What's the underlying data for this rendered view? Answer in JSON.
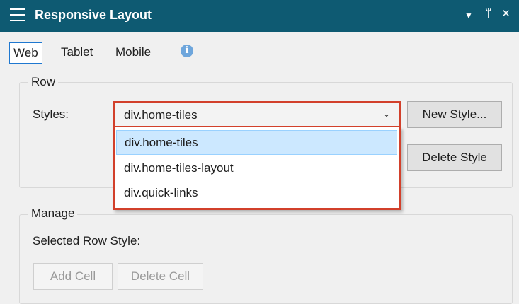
{
  "titlebar": {
    "title": "Responsive Layout",
    "icons": {
      "menu": "hamburger-icon",
      "dropdown": "triangle-down-icon",
      "pin": "pin-icon",
      "close": "close-icon"
    },
    "color": "#0e5a72"
  },
  "tabs": [
    {
      "label": "Web",
      "active": true
    },
    {
      "label": "Tablet",
      "active": false
    },
    {
      "label": "Mobile",
      "active": false
    }
  ],
  "info_icon": "info-icon",
  "row": {
    "title": "Row",
    "styles_label": "Styles:",
    "selected_style": "div.home-tiles",
    "options": [
      "div.home-tiles",
      "div.home-tiles-layout",
      "div.quick-links"
    ],
    "new_style_button": "New Style...",
    "delete_style_button": "Delete Style",
    "highlight_color": "#d2402b"
  },
  "manage": {
    "title": "Manage",
    "selected_row_style_label": "Selected Row Style:",
    "add_cell_button": "Add Cell",
    "delete_cell_button": "Delete Cell"
  }
}
